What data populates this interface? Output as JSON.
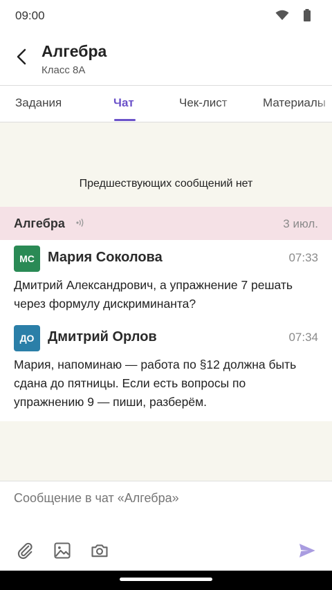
{
  "status_bar": {
    "time": "09:00",
    "icons": [
      "wifi-icon",
      "battery-icon"
    ]
  },
  "header": {
    "title": "Алгебра",
    "subtitle": "Класс 8А",
    "back_icon": "chevron-left-icon"
  },
  "tabs": [
    {
      "label": "Задания",
      "active": false
    },
    {
      "label": "Чат",
      "active": true
    },
    {
      "label": "Чек-лист",
      "active": false
    },
    {
      "label": "Материалы",
      "active": false
    }
  ],
  "chat": {
    "no_previous": "Предшествующих сообщений нет",
    "group": {
      "name": "Алгебра",
      "date": "3 июл.",
      "sound_icon": "sound-icon"
    },
    "messages": [
      {
        "initials": "МС",
        "author": "Мария Соколова",
        "time": "07:33",
        "avatar_color": "#2a8a55",
        "text": "Дмитрий Александрович, а упражнение 7 решать через формулу дискриминанта?"
      },
      {
        "initials": "ДО",
        "author": "Дмитрий Орлов",
        "time": "07:34",
        "avatar_color": "#2b7fa8",
        "text": "Мария, напоминаю — работа по §12 должна быть сдана до пятницы. Если есть вопросы по упражнению 9 — пиши, разберём."
      }
    ]
  },
  "composer": {
    "placeholder": "Сообщение в чат «Алгебра»",
    "buttons": [
      "paperclip-icon",
      "image-icon",
      "camera-icon",
      "send-icon"
    ]
  },
  "colors": {
    "accent": "#6b52c9",
    "chat_bg": "#f7f6ee",
    "banner_bg": "#f5e1e6"
  }
}
